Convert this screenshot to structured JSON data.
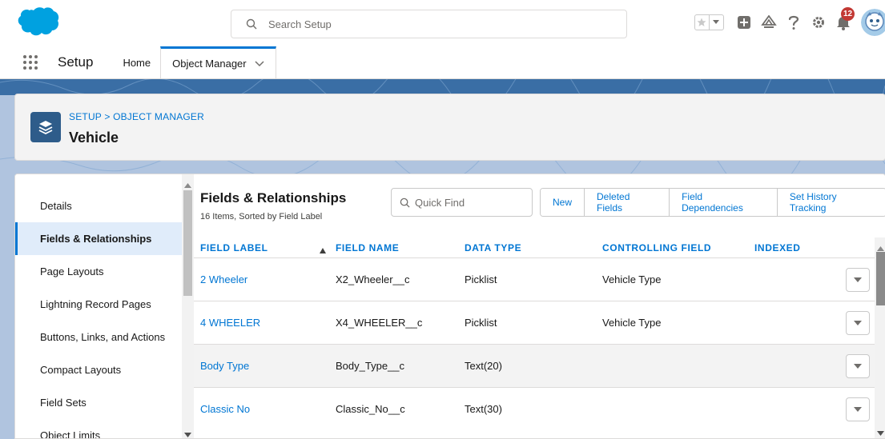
{
  "header": {
    "search_placeholder": "Search Setup",
    "notification_count": "12",
    "icons": [
      "favorites-star-icon",
      "favorites-list-icon",
      "global-actions-plus-icon",
      "trailhead-guidance-icon",
      "help-icon",
      "setup-gear-icon",
      "notifications-bell-icon",
      "user-avatar"
    ]
  },
  "context": {
    "app_name": "Setup",
    "tabs": [
      {
        "label": "Home"
      },
      {
        "label": "Object Manager"
      }
    ]
  },
  "page_header": {
    "breadcrumb": "SETUP > OBJECT MANAGER",
    "title": "Vehicle"
  },
  "left_nav": {
    "items": [
      {
        "label": "Details"
      },
      {
        "label": "Fields & Relationships"
      },
      {
        "label": "Page Layouts"
      },
      {
        "label": "Lightning Record Pages"
      },
      {
        "label": "Buttons, Links, and Actions"
      },
      {
        "label": "Compact Layouts"
      },
      {
        "label": "Field Sets"
      },
      {
        "label": "Object Limits"
      }
    ],
    "selected": "Fields & Relationships"
  },
  "fields": {
    "title": "Fields & Relationships",
    "subtitle": "16 Items, Sorted by Field Label",
    "quick_find_placeholder": "Quick Find",
    "buttons": {
      "new": "New",
      "deleted_fields": "Deleted Fields",
      "field_dependencies": "Field Dependencies",
      "set_history_tracking": "Set History Tracking"
    },
    "columns": {
      "field_label": "FIELD LABEL",
      "field_name": "FIELD NAME",
      "data_type": "DATA TYPE",
      "controlling_field": "CONTROLLING FIELD",
      "indexed": "INDEXED"
    },
    "rows": [
      {
        "label": "2 Wheeler",
        "name": "X2_Wheeler__c",
        "type": "Picklist",
        "controlling": "Vehicle Type"
      },
      {
        "label": "4 WHEELER",
        "name": "X4_WHEELER__c",
        "type": "Picklist",
        "controlling": "Vehicle Type"
      },
      {
        "label": "Body Type",
        "name": "Body_Type__c",
        "type": "Text(20)",
        "controlling": ""
      },
      {
        "label": "Classic No",
        "name": "Classic_No__c",
        "type": "Text(30)",
        "controlling": ""
      }
    ]
  },
  "colors": {
    "brand_blue": "#0176d3",
    "salesforce_cloud": "#00a1e0",
    "object_icon": "#2e5c8a",
    "notification_badge": "#c23934"
  }
}
